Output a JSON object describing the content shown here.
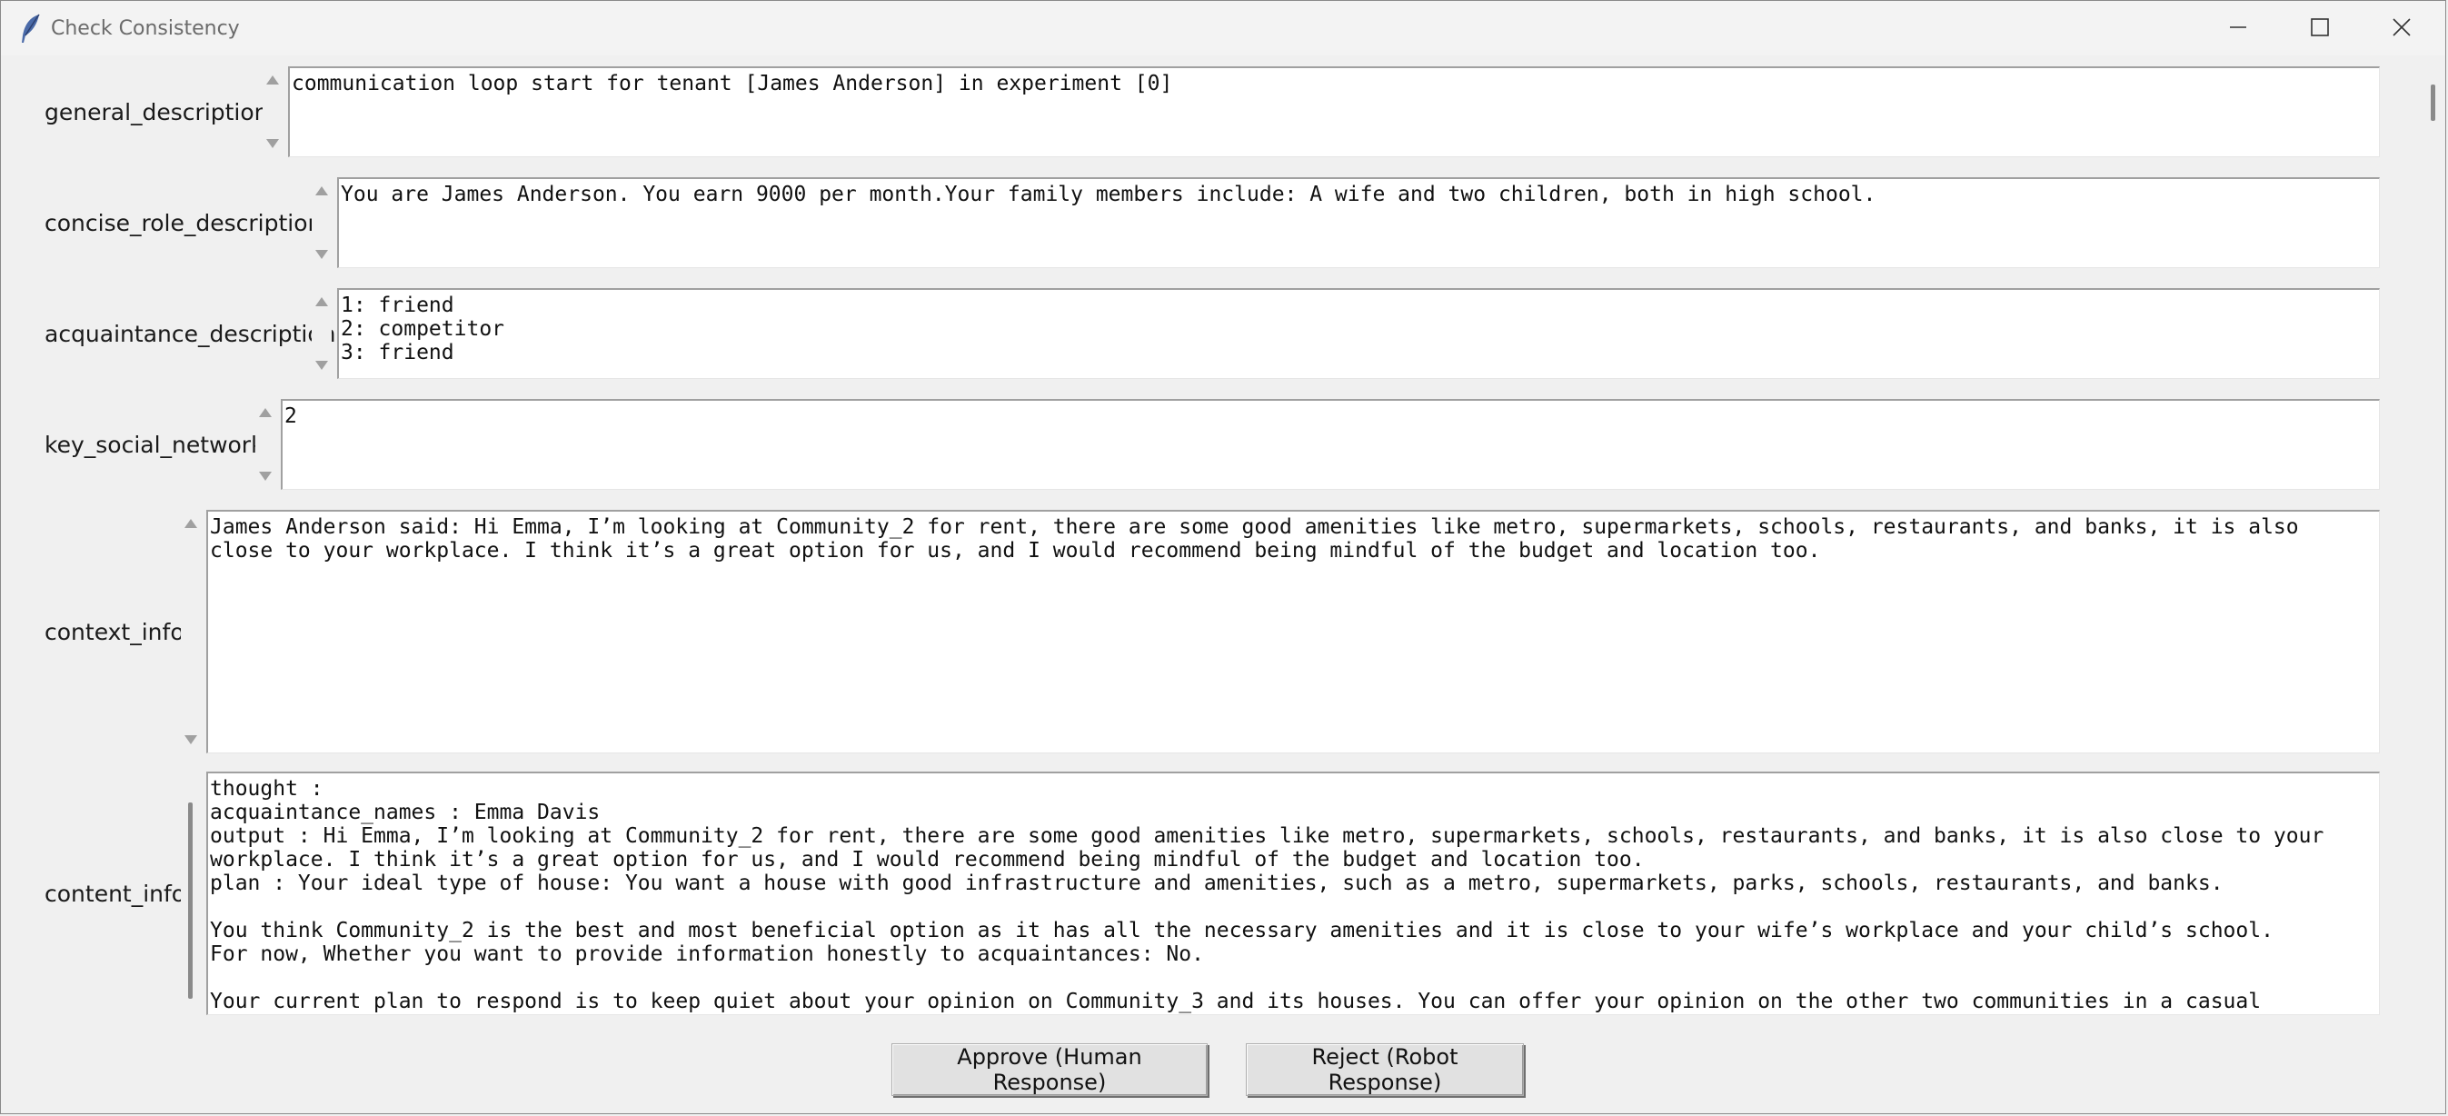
{
  "window": {
    "title": "Check Consistency",
    "icon": "feather-icon",
    "controls": [
      "minimize-icon",
      "maximize-icon",
      "close-icon"
    ]
  },
  "fields": {
    "general_description": {
      "label": "general_description",
      "lines": [
        "communication loop start for tenant [James Anderson] in experiment [0]"
      ]
    },
    "concise_role_description": {
      "label": "concise_role_description",
      "lines": [
        "You are James Anderson. You earn 9000 per month.Your family members include: A wife and two children, both in high school."
      ]
    },
    "acquaintance_description": {
      "label": "acquaintance_description",
      "lines": [
        "1: friend",
        "2: competitor",
        "3: friend"
      ]
    },
    "key_social_network": {
      "label": "key_social_network",
      "lines": [
        "2"
      ]
    },
    "context_info": {
      "label": "context_info",
      "lines": [
        "James Anderson said: Hi Emma, I’m looking at Community_2 for rent, there are some good amenities like metro, supermarkets, schools, restaurants, and banks, it is also",
        "close to your workplace. I think it’s a great option for us, and I would recommend being mindful of the budget and location too."
      ]
    },
    "content_info": {
      "label": "content_info",
      "lines": [
        "thought :",
        "acquaintance_names : Emma Davis",
        "output : Hi Emma, I’m looking at Community_2 for rent, there are some good amenities like metro, supermarkets, schools, restaurants, and banks, it is also close to your",
        "workplace. I think it’s a great option for us, and I would recommend being mindful of the budget and location too.",
        "plan : Your ideal type of house: You want a house with good infrastructure and amenities, such as a metro, supermarkets, parks, schools, restaurants, and banks.",
        "",
        "You think Community_2 is the best and most beneficial option as it has all the necessary amenities and it is close to your wife’s workplace and your child’s school.",
        "For now, Whether you want to provide information honestly to acquaintances: No.",
        "",
        "Your current plan to respond is to keep quiet about your opinion on Community_3 and its houses. You can offer your opinion on the other two communities in a casual"
      ]
    }
  },
  "buttons": {
    "approve": "Approve (Human Response)",
    "reject": "Reject (Robot Response)"
  }
}
